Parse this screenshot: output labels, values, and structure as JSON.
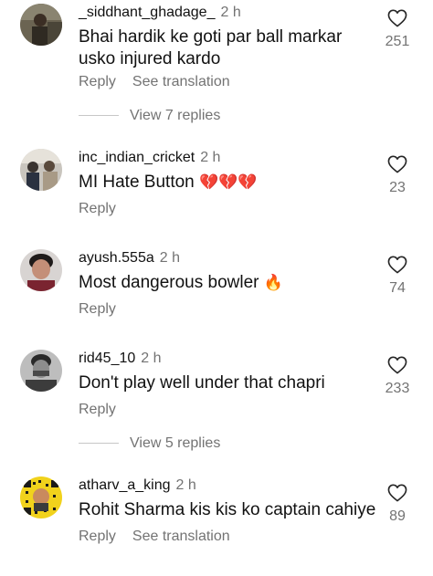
{
  "labels": {
    "reply": "Reply",
    "see_translation": "See translation"
  },
  "comments": [
    {
      "username": "_siddhant_ghadage_",
      "time": "2 h",
      "text": "Bhai hardik ke goti par ball markar usko injured kardo",
      "likes": "251",
      "view_replies": "View 7 replies"
    },
    {
      "username": "inc_indian_cricket",
      "time": "2 h",
      "text": "MI Hate Button",
      "emoji": "💔💔💔",
      "likes": "23"
    },
    {
      "username": "ayush.555a",
      "time": "2 h",
      "text": "Most dangerous bowler",
      "emoji": "🔥",
      "likes": "74"
    },
    {
      "username": "rid45_10",
      "time": "2 h",
      "text": "Don't play well under that chapri",
      "likes": "233",
      "view_replies": "View 5 replies"
    },
    {
      "username": "atharv_a_king",
      "time": "2 h",
      "text": "Rohit Sharma kis kis ko captain cahiye",
      "likes": "89"
    }
  ],
  "colors": {
    "primary_text": "#111111",
    "secondary_text": "#737373",
    "heart_outline": "#262626",
    "broken_heart": "#e0245e",
    "fire": "#ff6a00"
  },
  "icons": {
    "like": "heart-outline-icon",
    "broken_heart": "broken-heart-emoji",
    "fire": "fire-emoji"
  }
}
